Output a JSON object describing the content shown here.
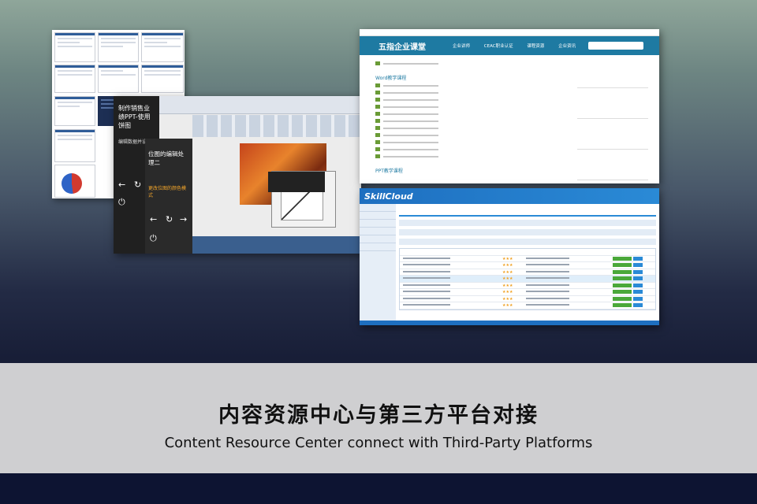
{
  "caption": {
    "title_cn": "内容资源中心与第三方平台对接",
    "title_en": "Content Resource Center connect with Third-Party Platforms"
  },
  "ppt": {
    "slide1_title": "制作销售业绩PPT-使用饼图",
    "slide1_sub": "编辑数据并设置",
    "slide2_title": "位图的编辑处理二",
    "slide2_step": "更改位图的颜色模式"
  },
  "portal": {
    "logo": "五指企业课堂",
    "nav": [
      "企业讲师",
      "CEAC职业认证",
      "课程资源",
      "企业资讯"
    ],
    "section": "Word教学课程",
    "section2": "PPT教学课程"
  },
  "skillcloud": {
    "logo": "SkillCloud"
  },
  "colors": {
    "hero_top": "#8fa69a",
    "hero_bottom": "#171d36",
    "band": "#cfcfd1",
    "portal_blue": "#1e7aa2",
    "skillcloud_blue": "#1e6fc0"
  }
}
